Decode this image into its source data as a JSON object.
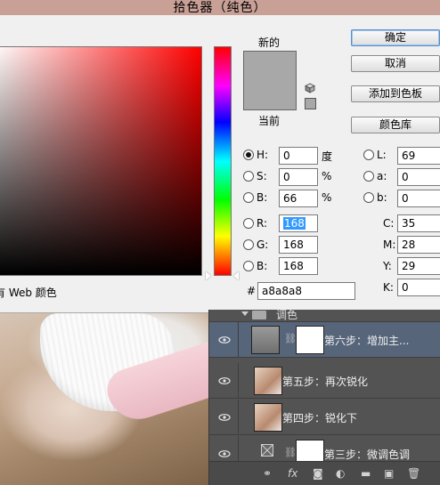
{
  "dialog": {
    "title": "拾色器（纯色）",
    "new_label": "新的",
    "current_label": "当前",
    "new_color": "#a8a8a8",
    "current_color": "#a8a8a8",
    "buttons": {
      "ok": "确定",
      "cancel": "取消",
      "add_to_swatches": "添加到色板",
      "color_libraries": "颜色库"
    },
    "only_web_colors_label": "有 Web 颜色",
    "hsb": [
      {
        "label": "H:",
        "value": "0",
        "unit": "度",
        "selected": true
      },
      {
        "label": "S:",
        "value": "0",
        "unit": "%",
        "selected": false
      },
      {
        "label": "B:",
        "value": "66",
        "unit": "%",
        "selected": false
      }
    ],
    "rgb": [
      {
        "label": "R:",
        "value": "168",
        "selected": false
      },
      {
        "label": "G:",
        "value": "168",
        "selected": false
      },
      {
        "label": "B:",
        "value": "168",
        "selected": false
      }
    ],
    "lab": [
      {
        "label": "L:",
        "value": "69"
      },
      {
        "label": "a:",
        "value": "0"
      },
      {
        "label": "b:",
        "value": "0"
      }
    ],
    "cmyk": [
      {
        "label": "C:",
        "value": "35",
        "unit": "%"
      },
      {
        "label": "M:",
        "value": "28",
        "unit": "%"
      },
      {
        "label": "Y:",
        "value": "29",
        "unit": "%"
      },
      {
        "label": "K:",
        "value": "0",
        "unit": "%"
      }
    ],
    "hex_label": "#",
    "hex_value": "a8a8a8"
  },
  "layers": {
    "group_name": "调色",
    "rows": [
      {
        "name": "第六步：增加主...",
        "type": "adjustment",
        "selected": true
      },
      {
        "name": "第五步：再次锐化",
        "type": "image",
        "selected": false
      },
      {
        "name": "第四步：锐化下",
        "type": "image",
        "selected": false
      },
      {
        "name": "第三步：微调色调",
        "type": "adjustment",
        "selected": false
      }
    ],
    "footer_icons": [
      "link-icon",
      "fx-icon",
      "mask-icon",
      "adjustment-icon",
      "folder-icon",
      "new-layer-icon",
      "trash-icon"
    ]
  }
}
